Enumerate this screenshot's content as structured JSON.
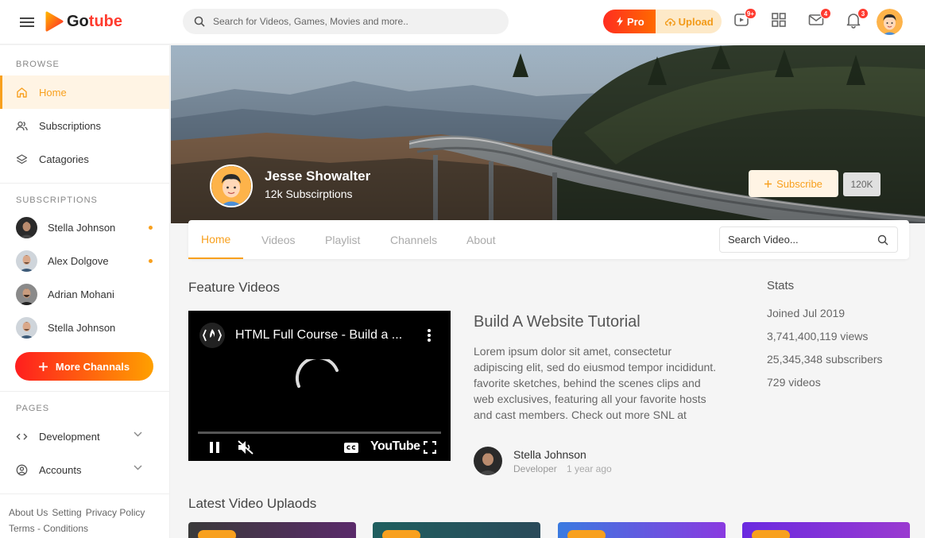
{
  "header": {
    "logo_text_1": "Go",
    "logo_text_2": "tube",
    "search_placeholder": "Search for Videos, Games, Movies and more..",
    "pro_label": "Pro",
    "upload_label": "Upload",
    "video_badge": "9+",
    "mail_badge": "4",
    "bell_badge": "3"
  },
  "sidebar": {
    "browse_title": "BROWSE",
    "browse_items": [
      {
        "label": "Home",
        "icon": "home-icon"
      },
      {
        "label": "Subscriptions",
        "icon": "users-icon"
      },
      {
        "label": "Catagories",
        "icon": "layers-icon"
      }
    ],
    "subscriptions_title": "SUBSCRIPTIONS",
    "subscriptions": [
      {
        "name": "Stella Johnson"
      },
      {
        "name": "Alex Dolgove"
      },
      {
        "name": "Adrian Mohani"
      },
      {
        "name": "Stella Johnson"
      }
    ],
    "more_label": "More Channals",
    "pages_title": "PAGES",
    "pages": [
      {
        "label": "Development",
        "icon": "code-icon"
      },
      {
        "label": "Accounts",
        "icon": "user-circle-icon"
      }
    ],
    "footer_links": [
      "About Us",
      "Setting",
      "Privacy Policy",
      "Terms - Conditions"
    ]
  },
  "channel": {
    "name": "Jesse Showalter",
    "subscribers": "12k Subscirptions",
    "subscribe_label": "Subscribe",
    "subscribe_count": "120K"
  },
  "tabs": {
    "items": [
      "Home",
      "Videos",
      "Playlist",
      "Channels",
      "About"
    ],
    "active": "Home",
    "search_placeholder": "Search Video..."
  },
  "feature": {
    "section_title": "Feature Videos",
    "player_title": "HTML Full Course - Build a ...",
    "player_brand": "YouTube",
    "title": "Build A Website Tutorial",
    "description": "Lorem ipsum dolor sit amet, consectetur adipiscing elit, sed do eiusmod tempor incididunt. favorite sketches, behind the scenes clips and web exclusives, featuring all your favorite hosts and cast members. Check out more SNL at",
    "author_name": "Stella Johnson",
    "author_role": "Developer",
    "author_time": "1 year ago"
  },
  "stats": {
    "title": "Stats",
    "items": [
      "Joined Jul 2019",
      "3,741,400,119 views",
      "25,345,348 subscribers",
      "729 videos"
    ]
  },
  "latest": {
    "section_title": "Latest Video Uplaods"
  },
  "colors": {
    "accent": "#f8a01e",
    "brand_red": "#ff3c2f"
  }
}
